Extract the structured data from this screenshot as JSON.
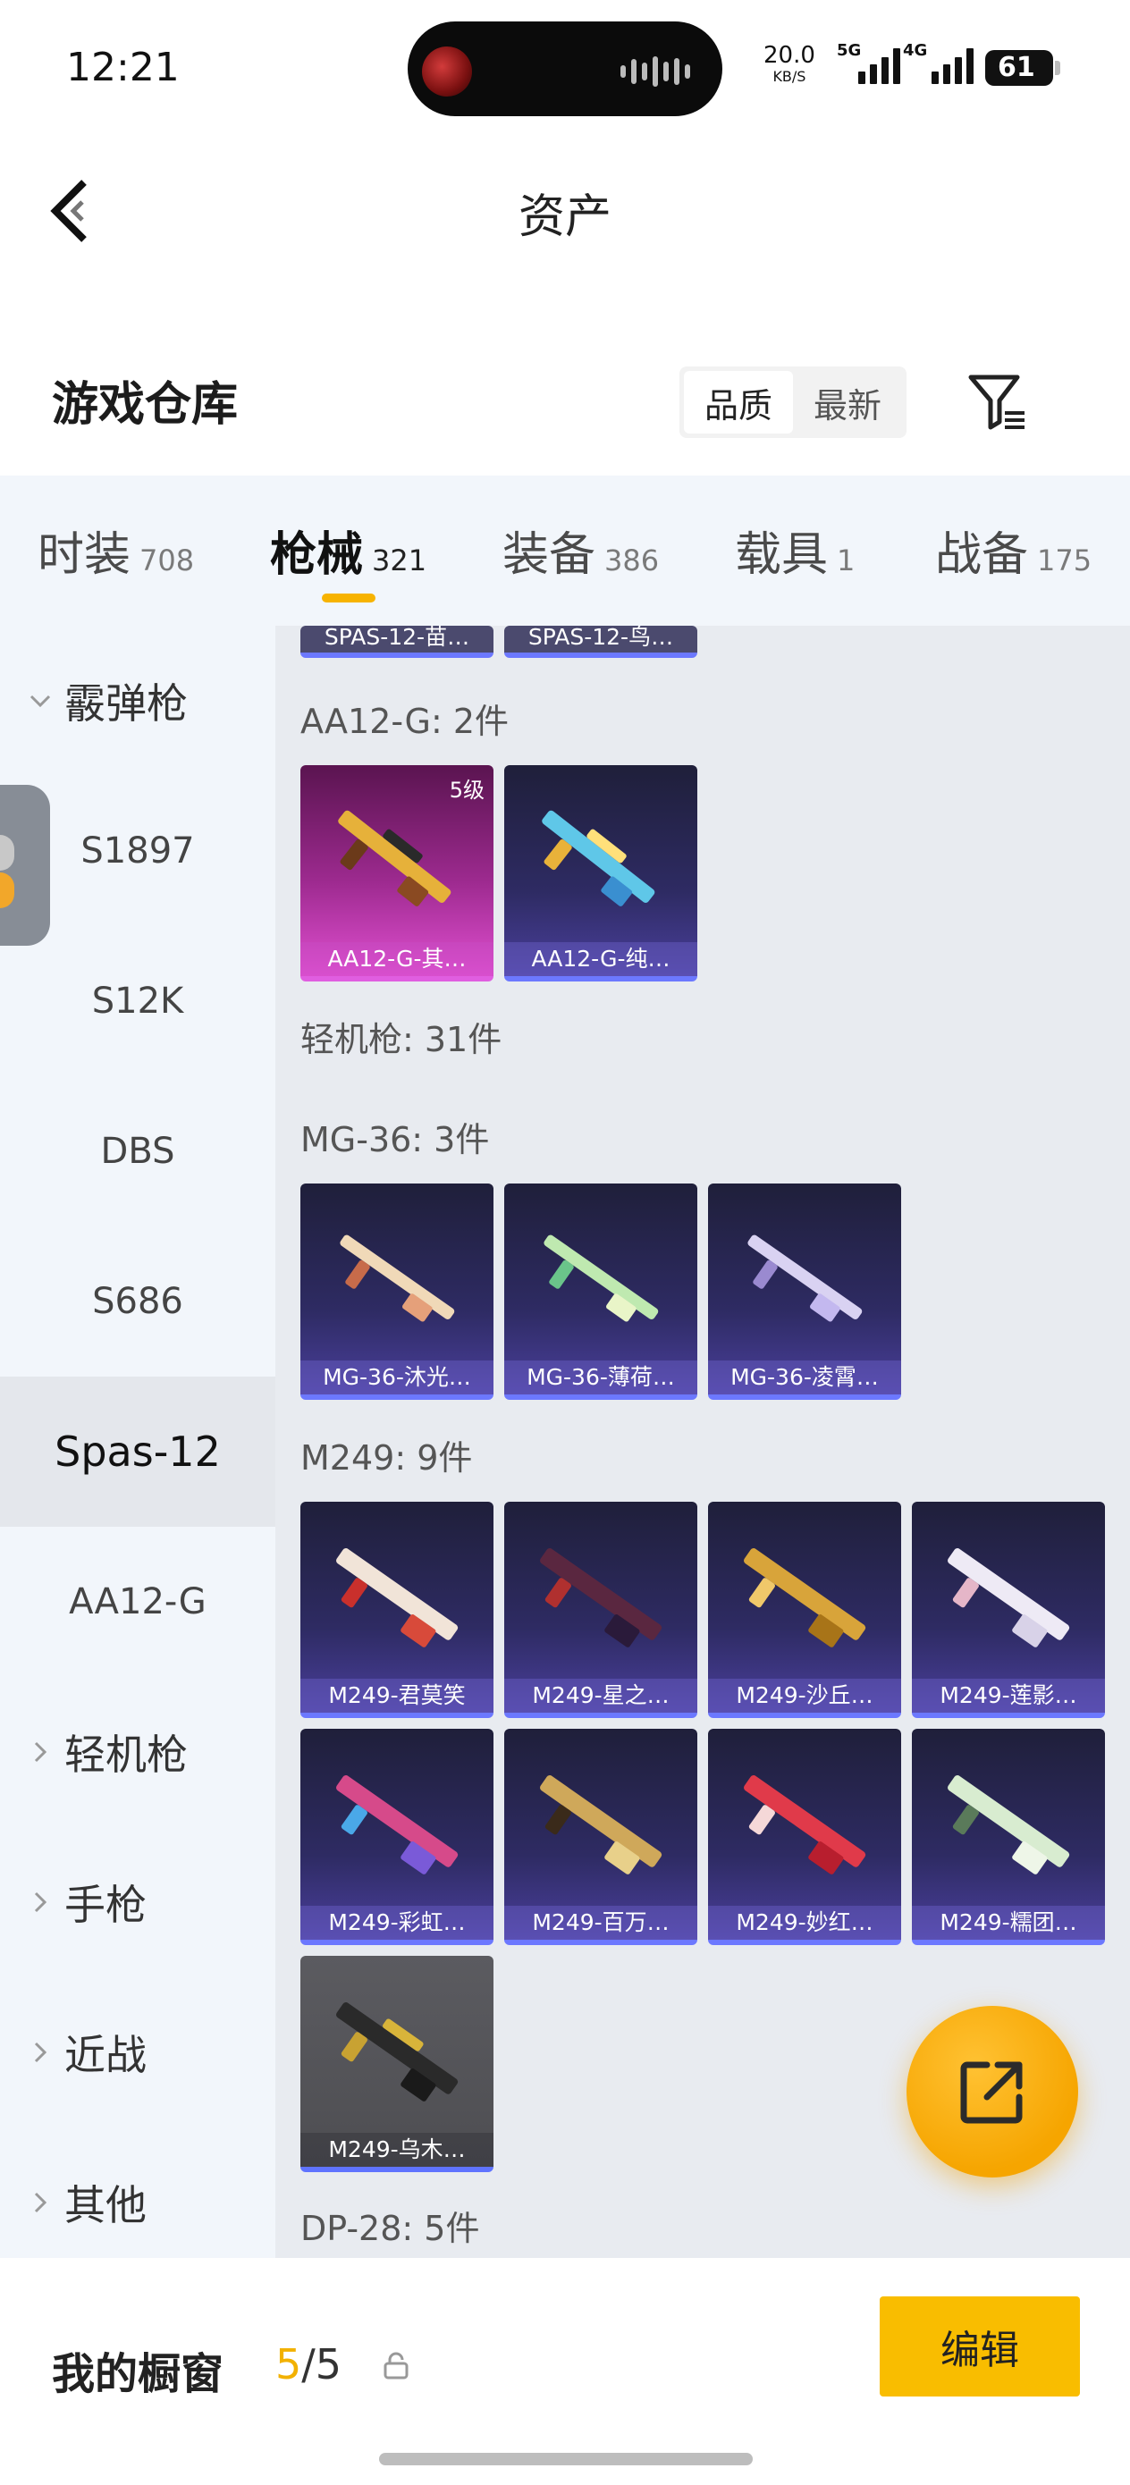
{
  "status_bar": {
    "time": "12:21",
    "net_speed": "20.0",
    "net_unit": "KB/S",
    "sig1": "5G",
    "sig2": "4G",
    "battery": "61"
  },
  "header": {
    "title": "资产"
  },
  "section": {
    "title": "游戏仓库",
    "sort_options": [
      "品质",
      "最新"
    ],
    "active_sort": "品质"
  },
  "categories": [
    {
      "name": "时装",
      "count": "708"
    },
    {
      "name": "枪械",
      "count": "321"
    },
    {
      "name": "装备",
      "count": "386"
    },
    {
      "name": "载具",
      "count": "1"
    },
    {
      "name": "战备",
      "count": "175"
    }
  ],
  "active_category": "枪械",
  "side_nav": [
    {
      "label": "霰弹枪",
      "type": "group",
      "expanded": true
    },
    {
      "label": "S1897",
      "type": "item"
    },
    {
      "label": "S12K",
      "type": "item"
    },
    {
      "label": "DBS",
      "type": "item"
    },
    {
      "label": "S686",
      "type": "item"
    },
    {
      "label": "Spas-12",
      "type": "item",
      "selected": true
    },
    {
      "label": "AA12-G",
      "type": "item"
    },
    {
      "label": "轻机枪",
      "type": "group",
      "expanded": false
    },
    {
      "label": "手枪",
      "type": "group",
      "expanded": false
    },
    {
      "label": "近战",
      "type": "group",
      "expanded": false
    },
    {
      "label": "其他",
      "type": "group",
      "expanded": false
    }
  ],
  "content": {
    "partial_top": [
      "SPAS-12-苗…",
      "SPAS-12-鸟…"
    ],
    "aa12_title": "AA12-G: 2件",
    "aa12": [
      {
        "name": "AA12-G-其…",
        "style": "purple-pink",
        "level": "5级"
      },
      {
        "name": "AA12-G-纯…",
        "style": "blue"
      }
    ],
    "lmg_title": "轻机枪: 31件",
    "mg36_title": "MG-36: 3件",
    "mg36": [
      {
        "name": "MG-36-沐光…"
      },
      {
        "name": "MG-36-薄荷…"
      },
      {
        "name": "MG-36-凌霄…"
      }
    ],
    "m249_title": "M249: 9件",
    "m249": [
      {
        "name": "M249-君莫笑"
      },
      {
        "name": "M249-星之…"
      },
      {
        "name": "M249-沙丘…"
      },
      {
        "name": "M249-莲影…"
      },
      {
        "name": "M249-彩虹…"
      },
      {
        "name": "M249-百万…"
      },
      {
        "name": "M249-妙红…"
      },
      {
        "name": "M249-糯团…"
      },
      {
        "name": "M249-乌木…",
        "style": "gray"
      }
    ],
    "dp28_title": "DP-28: 5件"
  },
  "bottom": {
    "showcase_label": "我的橱窗",
    "showcase_current": "5",
    "showcase_total": "/5",
    "edit_label": "编辑"
  },
  "colors": {
    "accent": "#f9bd00",
    "nav_bg": "#f2f6fb",
    "content_bg": "#e8ebf0"
  }
}
